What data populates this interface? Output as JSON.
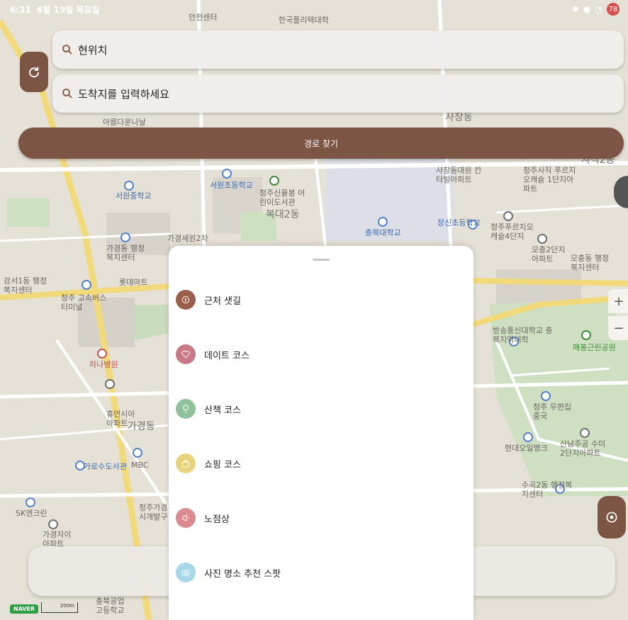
{
  "status_bar": {
    "time": "6:31",
    "date": "6월 19일 목요일",
    "battery": "78"
  },
  "search": {
    "origin": "현위치",
    "destination_placeholder": "도착지를 입력하세요"
  },
  "route_button": "경로 찾기",
  "map_controls": {
    "zoom_in": "+",
    "zoom_out": "−"
  },
  "map_labels": {
    "l1": "안전센터",
    "l2": "한국폴리텍대학",
    "l3": "아름다운나날",
    "l4": "사창동",
    "l5": "서원초등학교",
    "l6": "서원중학교",
    "l7": "청주신율봉 어린이도서관",
    "l8": "복대2동",
    "l9": "사창동대원 칸타빌아파트",
    "l10": "청주사직 푸르지오캐슬 1단지아파트",
    "l11": "사직2동",
    "l12": "충북대학교",
    "l13": "장신초등학교",
    "l14": "청주푸르지오 캐슬4단지",
    "l15": "모충2단지 아파트",
    "l16": "모충동 행정복지센터",
    "l17": "가경동 행정복지센터",
    "l18": "가경세원2차",
    "l19": "강서1동 행정복지센터",
    "l20": "롯데마트",
    "l21": "청주 고속버스터미널",
    "l22": "하나병원",
    "l23": "휴먼시아 아파트",
    "l24": "가경동",
    "l25": "가로수도서관",
    "l26": "MBC",
    "l27": "방송통신대학교 충북지역대학",
    "l28": "매봉근린공원",
    "l29": "청주 우편집중국",
    "l30": "산남주공 수미2단지아파트",
    "l31": "현대오일뱅크",
    "l32": "수곡2동 행정복지센터",
    "l33": "SK엔크린",
    "l34": "가경자이 아파트",
    "l35": "청주가경동 도시개발구",
    "l36": "충북공업 고등학교",
    "l37": "NAVER",
    "l38": "200m"
  },
  "bottom_sheet": {
    "options": [
      {
        "label": "근처 샛길",
        "icon": "compass-icon",
        "color": "#9a5f4a"
      },
      {
        "label": "데이트 코스",
        "icon": "heart-icon",
        "color": "#c97a86"
      },
      {
        "label": "산책 코스",
        "icon": "tree-icon",
        "color": "#8fc29d"
      },
      {
        "label": "쇼핑 코스",
        "icon": "basket-icon",
        "color": "#e8d47f"
      },
      {
        "label": "노점상",
        "icon": "megaphone-icon",
        "color": "#db8a8f"
      },
      {
        "label": "사진 명소 추천 스팟",
        "icon": "camera-icon",
        "color": "#a9d7ea"
      }
    ]
  },
  "colors": {
    "brand": "#7c5544",
    "map_bg": "#e6e1d6"
  }
}
